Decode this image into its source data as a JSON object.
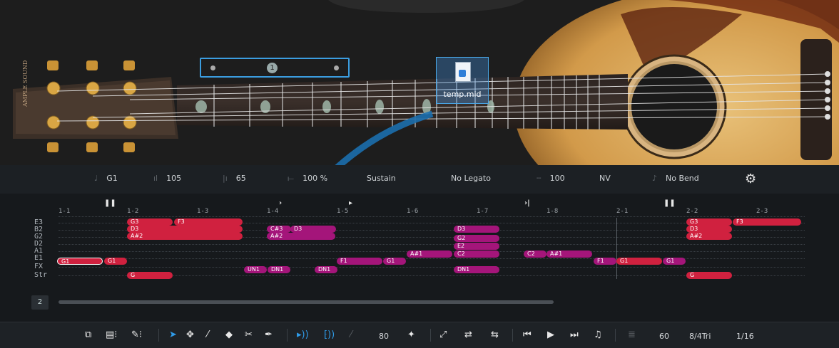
{
  "file_icon": {
    "name": "temp.mid",
    "icon": "midi-file-icon"
  },
  "position_box": {
    "number": "1"
  },
  "params": {
    "note": "G1",
    "velocity": "105",
    "position": "65",
    "length": "100 %",
    "articulation": "Sustain",
    "legato": "No Legato",
    "strength": "100",
    "nv": "NV",
    "bend": "No Bend"
  },
  "ruler": [
    "1-1",
    "1-2",
    "1-3",
    "1-4",
    "1-5",
    "1-6",
    "1-7",
    "1-8",
    "2-1",
    "2-2",
    "2-3"
  ],
  "rows": [
    "E3",
    "B2",
    "G2",
    "D2",
    "A1",
    "E1",
    "FX",
    "Str"
  ],
  "notes": [
    {
      "t": "G3"
    },
    {
      "t": "F3"
    },
    {
      "t": "D3"
    },
    {
      "t": "A#2"
    },
    {
      "t": "G"
    },
    {
      "t": "G1"
    },
    {
      "t": "G1"
    },
    {
      "t": "C#3"
    },
    {
      "t": "D3"
    },
    {
      "t": "A#2"
    },
    {
      "t": "UN1"
    },
    {
      "t": "DN1"
    },
    {
      "t": "DN1"
    },
    {
      "t": "F1"
    },
    {
      "t": "G1"
    },
    {
      "t": "A#1"
    },
    {
      "t": "D3"
    },
    {
      "t": "G2"
    },
    {
      "t": "E2"
    },
    {
      "t": "C2"
    },
    {
      "t": "DN1"
    },
    {
      "t": "C2"
    },
    {
      "t": "A#1"
    },
    {
      "t": "F1"
    },
    {
      "t": "G1"
    },
    {
      "t": "G1"
    },
    {
      "t": "G3"
    },
    {
      "t": "F3"
    },
    {
      "t": "D3"
    },
    {
      "t": "A#2"
    },
    {
      "t": "G"
    }
  ],
  "page_number": "2",
  "toolbar": {
    "velocity": "80",
    "tempo": "60",
    "grid": "8/4Tri",
    "quantize": "1/16"
  }
}
